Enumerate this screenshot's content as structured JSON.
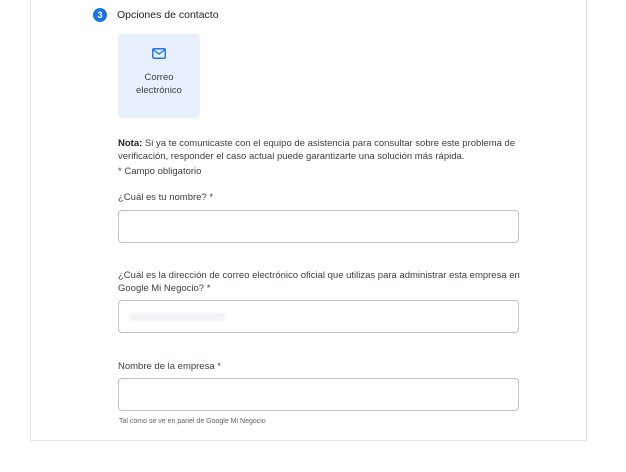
{
  "step": {
    "number": "3",
    "title": "Opciones de contacto"
  },
  "contact_option": {
    "icon": "mail-icon",
    "label": "Correo\nelectrónico",
    "accent": "#1a73e8",
    "background": "#e8f0fe"
  },
  "note": {
    "label": "Nota:",
    "text": " Si ya te comunicaste con el equipo de asistencia para consultar sobre este problema de verificación, responder el caso actual puede garantizarte una solución más rápida."
  },
  "required_note": "* Campo obligatorio",
  "fields": {
    "name": {
      "label": "¿Cuál es tu nombre? *",
      "value": ""
    },
    "email": {
      "label": "¿Cuál es la dirección de correo electrónico oficial que utilizas para administrar esta empresa en Google Mi Negocio? *",
      "value": ""
    },
    "business": {
      "label": "Nombre de la empresa *",
      "value": "",
      "helper": "Tal como se ve en panel de Google Mi Negocio"
    }
  }
}
